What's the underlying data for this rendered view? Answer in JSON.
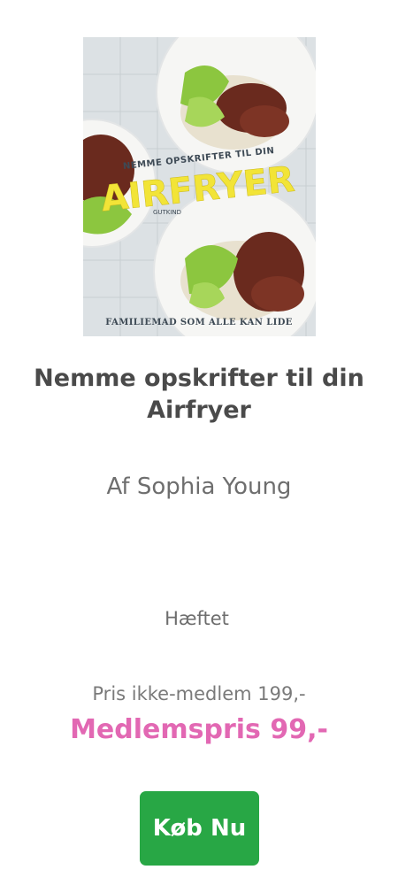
{
  "book": {
    "cover": {
      "top_text": "NEMME OPSKRIFTER TIL DIN",
      "main_text": "AIRFRYER",
      "publisher": "GUTKIND",
      "bottom_text": "FAMILIEMAD SOM ALLE KAN LIDE",
      "colors": {
        "title": "#f2e437",
        "text": "#3e4a55",
        "plate": "#f6f6f4",
        "meat": "#6a2a1e",
        "greens": "#8cc63f"
      }
    },
    "title": "Nemme opskrifter til din Airfryer",
    "author": "Af Sophia Young",
    "format": "Hæftet",
    "price_regular": "Pris ikke-medlem 199,-",
    "price_member": "Medlemspris 99,-",
    "buy_label": "Køb Nu"
  },
  "colors": {
    "member_price": "#e268b3",
    "button": "#28a745"
  }
}
